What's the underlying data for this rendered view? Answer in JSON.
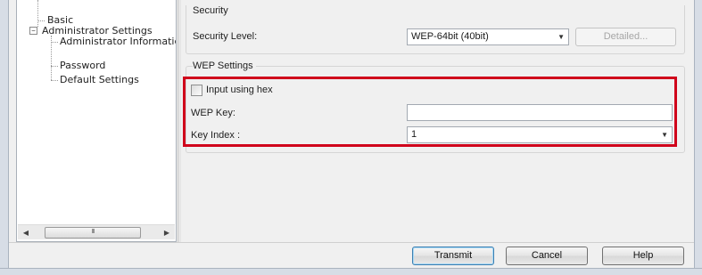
{
  "tree": {
    "items": [
      {
        "label": "Basic"
      },
      {
        "label": "Administrator Settings"
      },
      {
        "label": "Administrator Informatic"
      },
      {
        "label": "Password"
      },
      {
        "label": "Default Settings"
      }
    ],
    "expander_symbol": "−",
    "scroll_thumb_grip": "III",
    "scroll_left_icon": "◀",
    "scroll_right_icon": "▶"
  },
  "security": {
    "group_title": "Security",
    "level_label": "Security Level:",
    "level_value": "WEP-64bit (40bit)",
    "detailed_button": "Detailed..."
  },
  "wep": {
    "group_title": "WEP Settings",
    "hex_checkbox_label": "Input using hex",
    "hex_checked": false,
    "key_label": "WEP Key:",
    "key_value": "",
    "index_label": "Key Index :",
    "index_value": "1"
  },
  "buttons": {
    "transmit": "Transmit",
    "cancel": "Cancel",
    "help": "Help"
  },
  "colors": {
    "highlight": "#d0021b",
    "window_frame": "#d7dde6"
  }
}
